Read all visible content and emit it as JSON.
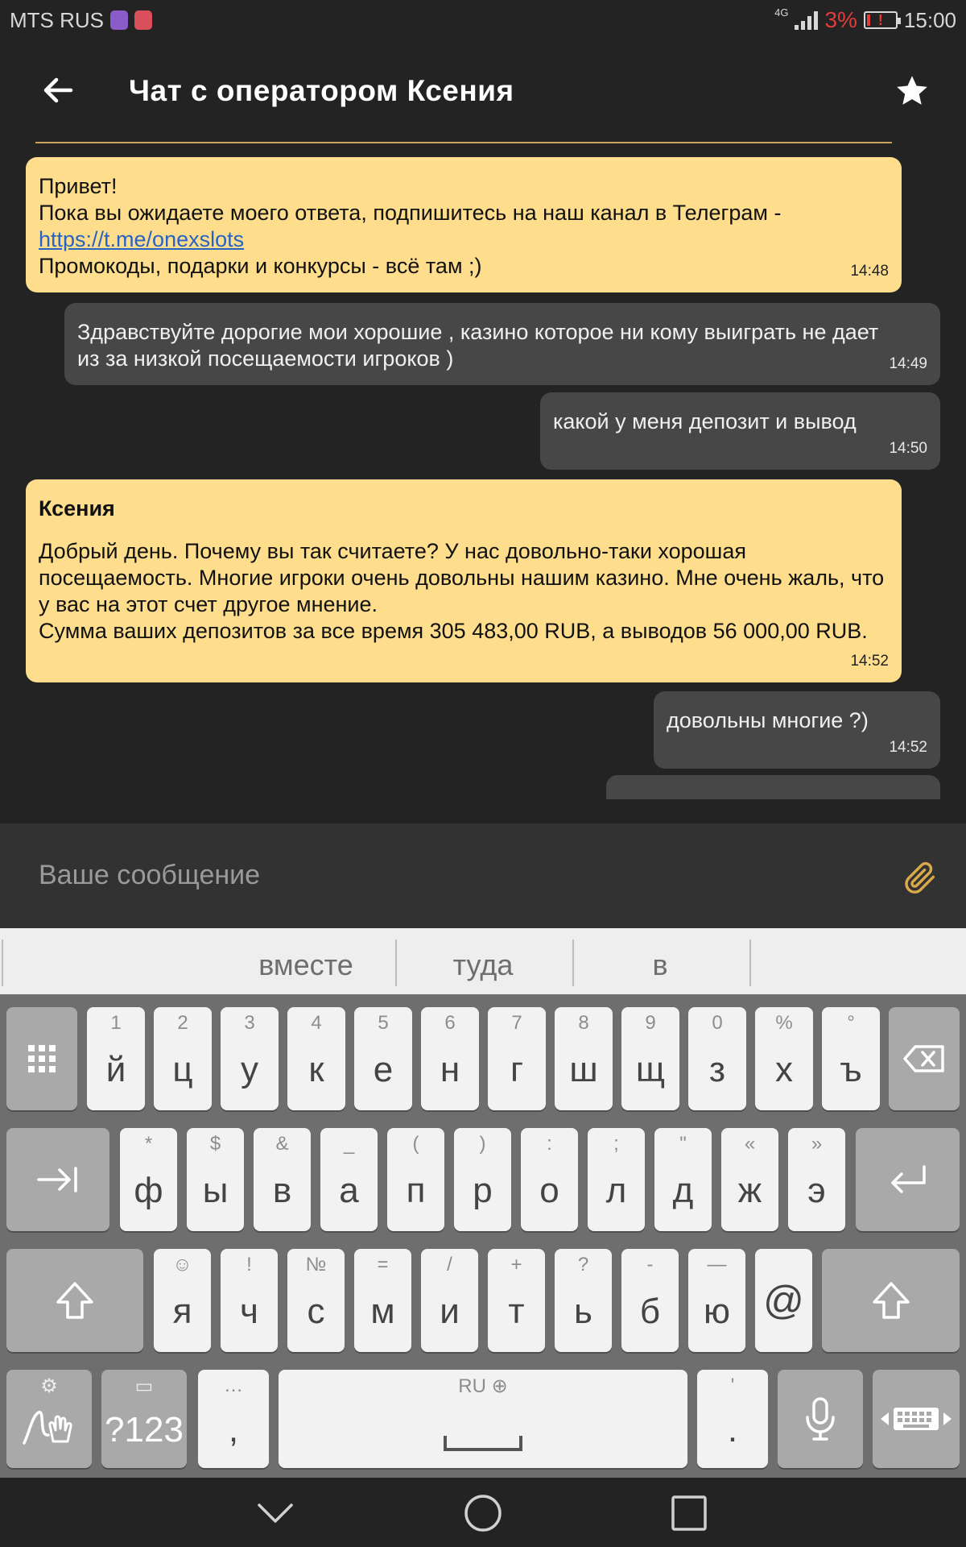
{
  "status_bar": {
    "carrier": "MTS RUS",
    "network": "4G",
    "battery_percent": "3%",
    "time": "15:00",
    "low_battery_color": "#e23b3b"
  },
  "header": {
    "title": "Чат с оператором Ксения",
    "back_icon": "arrow-left-icon",
    "favorite_icon": "star-icon",
    "divider_color": "#c9a35a"
  },
  "messages": [
    {
      "side": "operator",
      "line1": "Привет!",
      "line2": "Пока вы ожидаете моего ответа, подпишитесь на наш канал в Телеграм -",
      "link": "https://t.me/onexslots",
      "line3": "Промокоды, подарки и конкурсы - всё там ;)",
      "time": "14:48"
    },
    {
      "side": "user",
      "text": "Здравствуйте дорогие мои хорошие , казино которое ни кому выиграть не дает из за низкой посещаемости игроков )",
      "time": "14:49"
    },
    {
      "side": "user",
      "text": "какой у меня депозит и вывод",
      "time": "14:50"
    },
    {
      "side": "operator",
      "sender": "Ксения",
      "text1": "Добрый день. Почему вы так считаете? У нас довольно-таки хорошая посещаемость. Многие игроки очень довольны нашим казино. Мне очень жаль, что у вас на этот счет другое мнение.",
      "text2": "Сумма ваших депозитов за все время 305 483,00 RUB, а выводов 56 000,00 RUB.",
      "time": "14:52"
    },
    {
      "side": "user",
      "text": "довольны многие ?)",
      "time": "14:52"
    }
  ],
  "composer": {
    "placeholder": "Ваше сообщение",
    "attach_icon": "paperclip-icon"
  },
  "keyboard": {
    "suggestions": [
      "вместе",
      "туда",
      "в"
    ],
    "row1": [
      {
        "hint": "1",
        "key": "й"
      },
      {
        "hint": "2",
        "key": "ц"
      },
      {
        "hint": "3",
        "key": "у"
      },
      {
        "hint": "4",
        "key": "к"
      },
      {
        "hint": "5",
        "key": "е"
      },
      {
        "hint": "6",
        "key": "н"
      },
      {
        "hint": "7",
        "key": "г"
      },
      {
        "hint": "8",
        "key": "ш"
      },
      {
        "hint": "9",
        "key": "щ"
      },
      {
        "hint": "0",
        "key": "з"
      },
      {
        "hint": "%",
        "key": "х"
      },
      {
        "hint": "°",
        "key": "ъ"
      }
    ],
    "row2": [
      {
        "hint": "*",
        "key": "ф"
      },
      {
        "hint": "$",
        "key": "ы"
      },
      {
        "hint": "&",
        "key": "в"
      },
      {
        "hint": "_",
        "key": "а"
      },
      {
        "hint": "(",
        "key": "п"
      },
      {
        "hint": ")",
        "key": "р"
      },
      {
        "hint": ":",
        "key": "о"
      },
      {
        "hint": ";",
        "key": "л"
      },
      {
        "hint": "\"",
        "key": "д"
      },
      {
        "hint": "«",
        "key": "ж"
      },
      {
        "hint": "»",
        "key": "э"
      }
    ],
    "row3": [
      {
        "hint": "☺",
        "key": "я"
      },
      {
        "hint": "!",
        "key": "ч"
      },
      {
        "hint": "№",
        "key": "с"
      },
      {
        "hint": "=",
        "key": "м"
      },
      {
        "hint": "/",
        "key": "и"
      },
      {
        "hint": "+",
        "key": "т"
      },
      {
        "hint": "?",
        "key": "ь"
      },
      {
        "hint": "-",
        "key": "б"
      },
      {
        "hint": "—",
        "key": "ю"
      },
      {
        "hint": "",
        "key": "@"
      }
    ],
    "symbols_label": "?123",
    "comma_hint": "…",
    "comma": ",",
    "space_hint": "RU",
    "period_hint": "'",
    "period": "."
  }
}
